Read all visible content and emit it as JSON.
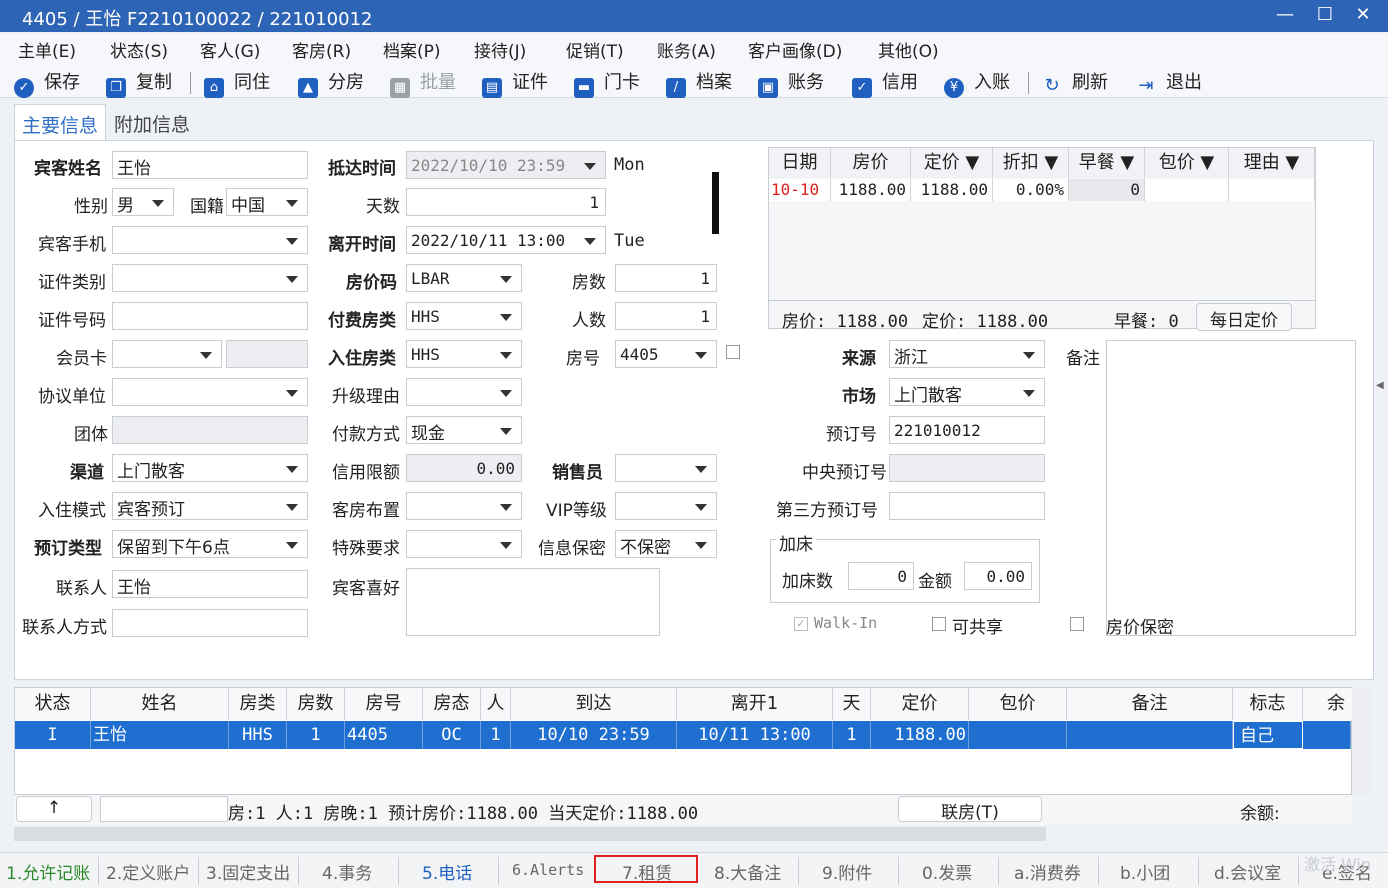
{
  "window": {
    "title": "4405 / 王怡 F2210100022 / 221010012"
  },
  "menu": [
    "主单(E)",
    "状态(S)",
    "客人(G)",
    "客房(R)",
    "档案(P)",
    "接待(J)",
    "促销(T)",
    "账务(A)",
    "客户画像(D)",
    "其他(O)"
  ],
  "toolbar": {
    "save": "保存",
    "copy": "复制",
    "share": "同住",
    "split": "分房",
    "batch": "批量",
    "cert": "证件",
    "card": "门卡",
    "archive": "档案",
    "account": "账务",
    "credit": "信用",
    "post": "入账",
    "refresh": "刷新",
    "exit": "退出"
  },
  "tabs": {
    "main": "主要信息",
    "extra": "附加信息"
  },
  "form": {
    "guest_name_label": "宾客姓名",
    "guest_name": "王怡",
    "gender_label": "性别",
    "gender": "男",
    "nationality_label": "国籍",
    "nationality": "中国",
    "phone_label": "宾客手机",
    "phone": "",
    "idtype_label": "证件类别",
    "idtype": "",
    "idno_label": "证件号码",
    "idno": "",
    "member_label": "会员卡",
    "member": "",
    "agreement_label": "协议单位",
    "agreement": "",
    "group_label": "团体",
    "group": "",
    "channel_label": "渠道",
    "channel": "上门散客",
    "mode_label": "入住模式",
    "mode": "宾客预订",
    "rtype_label": "预订类型",
    "rtype": "保留到下午6点",
    "contact_label": "联系人",
    "contact": "王怡",
    "contact_way_label": "联系人方式",
    "contact_way": "",
    "arrive_label": "抵达时间",
    "arrive": "2022/10/10 23:59",
    "arrive_day": "Mon",
    "days_label": "天数",
    "days": "1",
    "depart_label": "离开时间",
    "depart": "2022/10/11 13:00",
    "depart_day": "Tue",
    "ratecode_label": "房价码",
    "ratecode": "LBAR",
    "rooms_label": "房数",
    "rooms": "1",
    "paytype_label": "付费房类",
    "paytype": "HHS",
    "persons_label": "人数",
    "persons": "1",
    "roomtype_label": "入住房类",
    "roomtype": "HHS",
    "roomno_label": "房号",
    "roomno": "4405",
    "upgrade_label": "升级理由",
    "upgrade": "",
    "payment_label": "付款方式",
    "payment": "现金",
    "credit_label": "信用限额",
    "credit": "0.00",
    "sales_label": "销售员",
    "sales": "",
    "layout_label": "客房布置",
    "layout": "",
    "vip_label": "VIP等级",
    "vip": "",
    "special_label": "特殊要求",
    "special": "",
    "privacy_label": "信息保密",
    "privacy": "不保密",
    "pref_label": "宾客喜好",
    "pref": "",
    "source_label": "来源",
    "source": "浙江",
    "remark_label": "备注",
    "market_label": "市场",
    "market": "上门散客",
    "resno_label": "预订号",
    "resno": "221010012",
    "central_label": "中央预订号",
    "central": "",
    "third_label": "第三方预订号",
    "third": "",
    "extrabed_title": "加床",
    "extrabed_count_label": "加床数",
    "extrabed_count": "0",
    "extrabed_amount_label": "金额",
    "extrabed_amount": "0.00",
    "walkin": "Walk-In",
    "shareable": "可共享",
    "rate_secret": "房价保密"
  },
  "rate_grid": {
    "headers": [
      "日期",
      "房价",
      "定价 ▼",
      "折扣 ▼",
      "早餐 ▼",
      "包价 ▼",
      "理由 ▼"
    ],
    "row": [
      "10-10",
      "1188.00",
      "1188.00",
      "0.00%",
      "0",
      "",
      ""
    ],
    "summary": {
      "price": "房价: 1188.00",
      "fixed": "定价: 1188.00",
      "breakfast": "早餐: 0",
      "daily_btn": "每日定价"
    }
  },
  "grid": {
    "headers": [
      "状态",
      "姓名",
      "房类",
      "房数",
      "房号",
      "房态",
      "人",
      "到达",
      "离开1",
      "天",
      "定价",
      "包价",
      "备注",
      "标志",
      "余额"
    ],
    "row": [
      "I",
      "王怡",
      "HHS",
      "1",
      "4405",
      "OC",
      "1",
      "10/10 23:59",
      "10/11 13:00",
      "1",
      "1188.00",
      "",
      "",
      "自己",
      ""
    ]
  },
  "summary_bar": {
    "up": "↑",
    "stats": "房:1  人:1  房晚:1  预计房价:1188.00  当天定价:1188.00",
    "joint": "联房(T)",
    "balance": "余额:"
  },
  "bottom_tabs": [
    "1.允许记账",
    "2.定义账户",
    "3.固定支出",
    "4.事务",
    "5.电话",
    "6.Alerts",
    "7.租赁",
    "8.大备注",
    "9.附件",
    "0.发票",
    "a.消费券",
    "b.小团",
    "d.会议室",
    "e.签名"
  ],
  "watermark": "激活 Win"
}
